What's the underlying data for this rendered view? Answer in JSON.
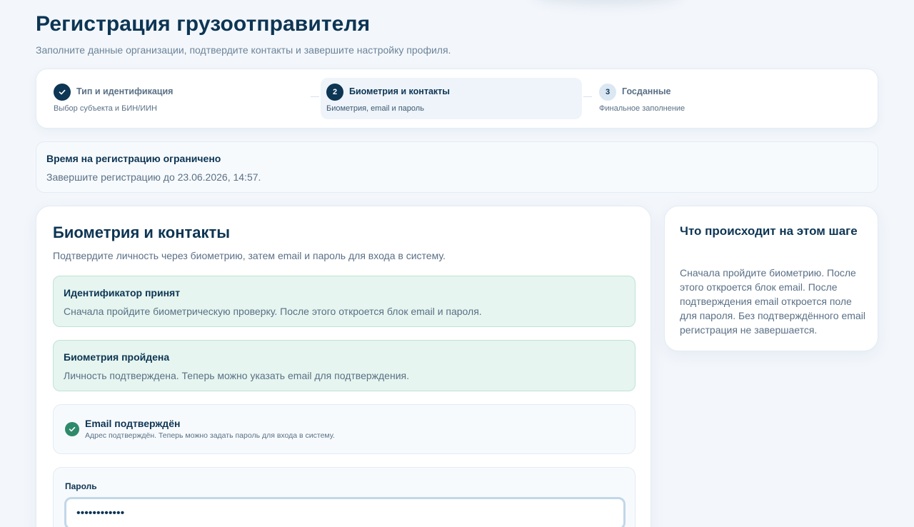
{
  "header": {
    "title": "Регистрация грузоотправителя",
    "subtitle": "Заполните данные организации, подтвердите контакты и завершите настройку профиля."
  },
  "stepper": {
    "steps": [
      {
        "number": "1",
        "title": "Тип и идентификация",
        "desc": "Выбор субъекта и БИН/ИИН",
        "state": "done"
      },
      {
        "number": "2",
        "title": "Биометрия и контакты",
        "desc": "Биометрия, email и пароль",
        "state": "active"
      },
      {
        "number": "3",
        "title": "Госданные",
        "desc": "Финальное заполнение",
        "state": "pending"
      }
    ]
  },
  "notice": {
    "title": "Время на регистрацию ограничено",
    "text": "Завершите регистрацию до 23.06.2026, 14:57."
  },
  "main": {
    "title": "Биометрия и контакты",
    "subtitle": "Подтвердите личность через биометрию, затем email и пароль для входа в систему.",
    "status_identifier": {
      "title": "Идентификатор принят",
      "text": "Сначала пройдите биометрическую проверку. После этого откроется блок email и пароля."
    },
    "status_biometry": {
      "title": "Биометрия пройдена",
      "text": "Личность подтверждена. Теперь можно указать email для подтверждения."
    },
    "email": {
      "title": "Email подтверждён",
      "text": "Адрес подтверждён. Теперь можно задать пароль для входа в систему."
    },
    "password": {
      "label": "Пароль",
      "value": "••••••••••••"
    }
  },
  "side": {
    "title": "Что происходит на этом шаге",
    "text": "Сначала пройдите биометрию. После этого откроется блок email. После подтверждения email откроется поле для пароля. Без подтверждённого email регистрация не завершается."
  },
  "colors": {
    "primary": "#0d3554",
    "success": "#2e8a6a",
    "success_bg": "#e6f5ef",
    "background": "#f3f7fc"
  }
}
